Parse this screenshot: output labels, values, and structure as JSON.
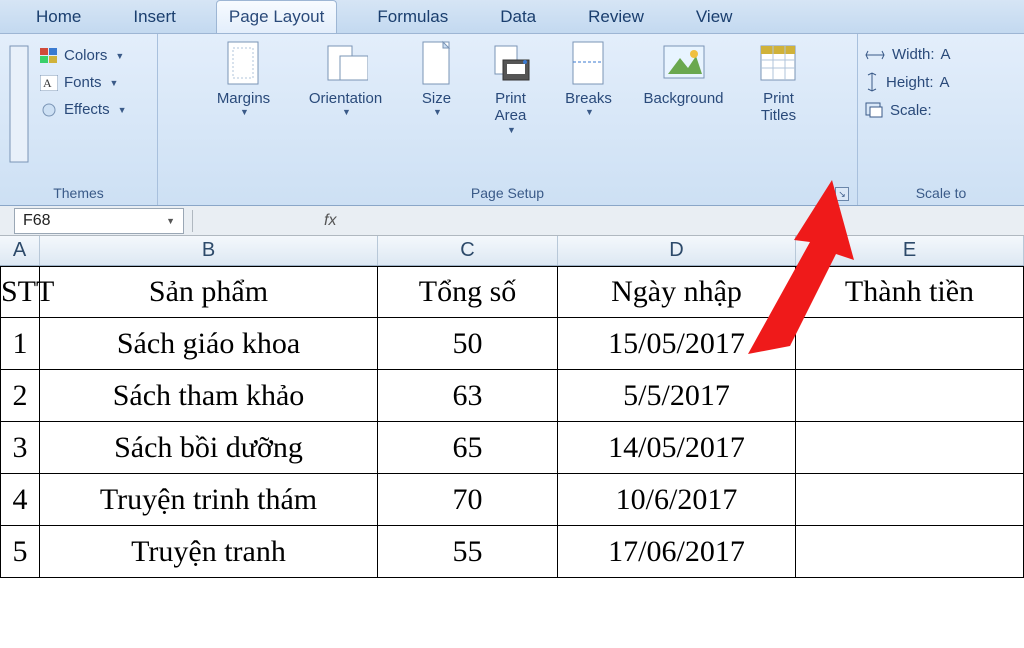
{
  "tabs": {
    "home": "Home",
    "insert": "Insert",
    "page_layout": "Page Layout",
    "formulas": "Formulas",
    "data": "Data",
    "review": "Review",
    "view": "View",
    "active": "page_layout"
  },
  "ribbon": {
    "themes": {
      "colors": "Colors",
      "fonts": "Fonts",
      "effects": "Effects",
      "label": "Themes"
    },
    "page_setup": {
      "margins": "Margins",
      "orientation": "Orientation",
      "size": "Size",
      "print_area": "Print\nArea",
      "breaks": "Breaks",
      "background": "Background",
      "print_titles": "Print\nTitles",
      "label": "Page Setup"
    },
    "scale": {
      "width": "Width:",
      "width_val": "A",
      "height": "Height:",
      "height_val": "A",
      "scale": "Scale:",
      "label": "Scale to"
    }
  },
  "namebox": "F68",
  "fx": "fx",
  "columns": {
    "a": "A",
    "b": "B",
    "c": "C",
    "d": "D",
    "e": "E"
  },
  "headers": {
    "a": "STT",
    "b": "Sản phẩm",
    "c": "Tổng số",
    "d": "Ngày nhập",
    "e": "Thành tiền"
  },
  "rows": [
    {
      "a": "1",
      "b": "Sách giáo khoa",
      "c": "50",
      "d": "15/05/2017",
      "e": ""
    },
    {
      "a": "2",
      "b": "Sách tham khảo",
      "c": "63",
      "d": "5/5/2017",
      "e": ""
    },
    {
      "a": "3",
      "b": "Sách bồi dưỡng",
      "c": "65",
      "d": "14/05/2017",
      "e": ""
    },
    {
      "a": "4",
      "b": "Truyện trinh thám",
      "c": "70",
      "d": "10/6/2017",
      "e": ""
    },
    {
      "a": "5",
      "b": "Truyện tranh",
      "c": "55",
      "d": "17/06/2017",
      "e": ""
    }
  ],
  "chart_data": {
    "type": "table",
    "title": "",
    "columns": [
      "STT",
      "Sản phẩm",
      "Tổng số",
      "Ngày nhập",
      "Thành tiền"
    ],
    "rows": [
      [
        1,
        "Sách giáo khoa",
        50,
        "15/05/2017",
        null
      ],
      [
        2,
        "Sách tham khảo",
        63,
        "5/5/2017",
        null
      ],
      [
        3,
        "Sách bồi dưỡng",
        65,
        "14/05/2017",
        null
      ],
      [
        4,
        "Truyện trinh thám",
        70,
        "10/6/2017",
        null
      ],
      [
        5,
        "Truyện tranh",
        55,
        "17/06/2017",
        null
      ]
    ]
  }
}
